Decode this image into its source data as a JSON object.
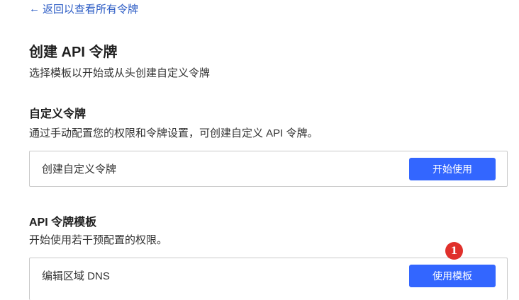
{
  "back_link": {
    "arrow": "←",
    "label": "返回以查看所有令牌"
  },
  "page": {
    "title": "创建 API 令牌",
    "subtitle": "选择模板以开始或从头创建自定义令牌"
  },
  "custom_section": {
    "title": "自定义令牌",
    "description": "通过手动配置您的权限和令牌设置，可创建自定义 API 令牌。",
    "card_label": "创建自定义令牌",
    "button_label": "开始使用"
  },
  "template_section": {
    "title": "API 令牌模板",
    "description": "开始使用若干预配置的权限。",
    "templates": [
      {
        "label": "编辑区域 DNS",
        "button_label": "使用模板"
      }
    ]
  },
  "annotation": {
    "badge": "1"
  },
  "colors": {
    "link": "#2c5cc5",
    "primary_button": "#3366ff",
    "badge": "#e0302b",
    "card_border": "#c9c9c9"
  }
}
